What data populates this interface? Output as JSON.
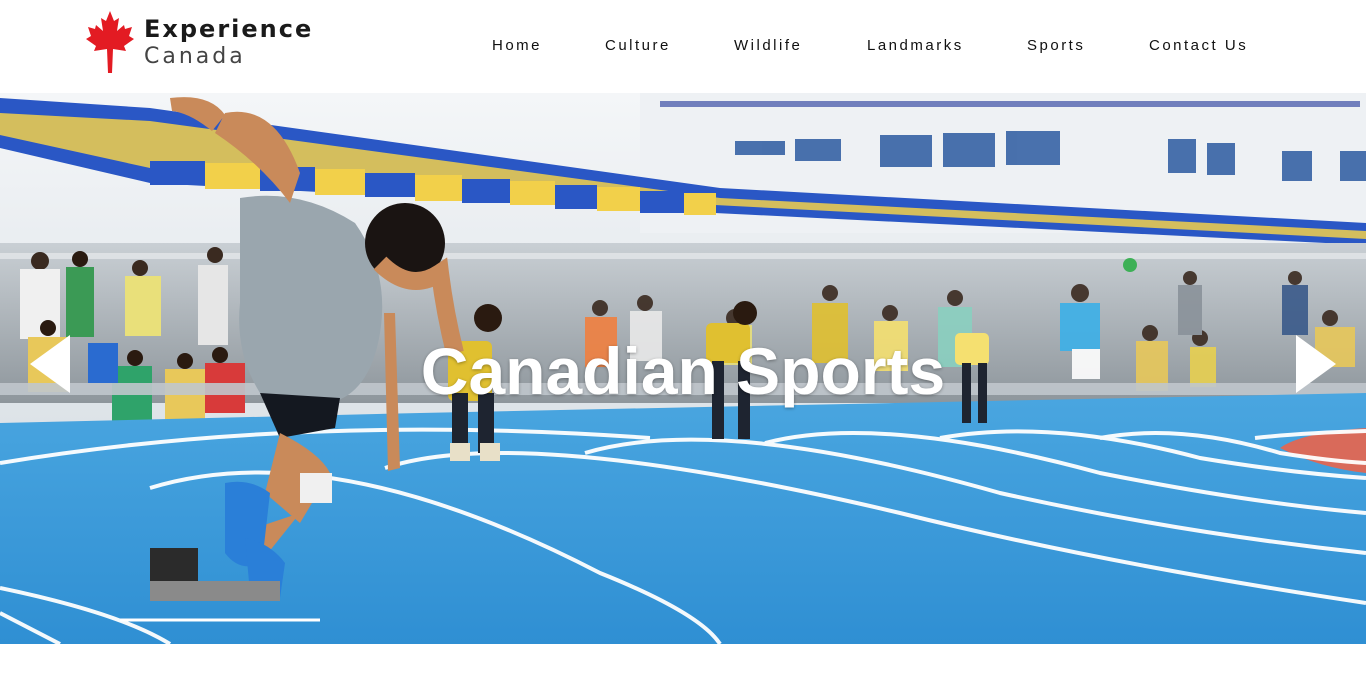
{
  "logo": {
    "line1": "Experience",
    "line2": "Canada",
    "icon": "maple-leaf-icon",
    "color": "#e31b23"
  },
  "nav": {
    "items": [
      {
        "label": "Home"
      },
      {
        "label": "Culture"
      },
      {
        "label": "Wildlife"
      },
      {
        "label": "Landmarks"
      },
      {
        "label": "Sports"
      },
      {
        "label": "Contact Us"
      }
    ]
  },
  "hero": {
    "title": "Canadian Sports",
    "prev_icon": "triangle-left-icon",
    "next_icon": "triangle-right-icon",
    "track_color": "#3a9ddc",
    "canopy_colors": [
      "#f2d04a",
      "#2a57c5"
    ]
  }
}
